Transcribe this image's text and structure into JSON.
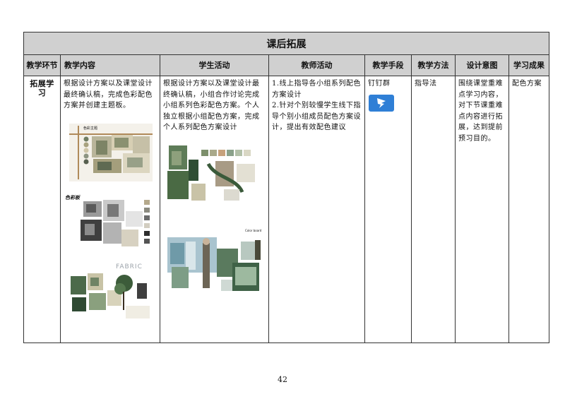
{
  "table": {
    "title": "课后拓展",
    "headers": [
      "教学环节",
      "教学内容",
      "学生活动",
      "教师活动",
      "教学手段",
      "教学方法",
      "设计意图",
      "学习成果"
    ],
    "row": {
      "stage": "拓展学习",
      "content": "根据设计方案以及课堂设计最终确认稿，完成色彩配色方案并创建主题板。",
      "student_activity": "根据设计方案以及课堂设计最终确认稿，小组合作讨论完成小组系列色彩配色方案。个人独立根据小组配色方案，完成个人系列配色方案设计",
      "teacher_activity": "1.线上指导各小组系列配色方案设计\n2.针对个别较慢学生线下指导个别小组成员配色方案设计，提出有效配色建议",
      "means": "钉钉群",
      "method": "指导法",
      "intent": "围绕课堂重难点学习内容，对下节课重难点内容进行拓展，达到提前预习目的。",
      "outcome": "配色方案"
    },
    "board_labels": {
      "board1": "色彩主题",
      "board2": "色彩板",
      "board3": "FABRIC",
      "board5": "Color board"
    }
  },
  "page_number": "42",
  "colors": {
    "header_bg": "#d0d0d0",
    "border": "#333333",
    "dingtalk_blue": "#2f7fd6"
  },
  "icons": [
    "dingtalk-icon"
  ]
}
